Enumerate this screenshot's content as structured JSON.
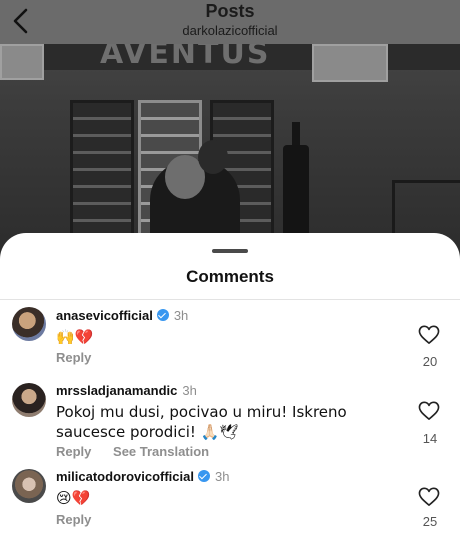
{
  "header": {
    "title": "Posts",
    "subtitle": "darkolazicofficial"
  },
  "photo": {
    "brand_text": "AVENTUS"
  },
  "sheet": {
    "title": "Comments"
  },
  "comments": [
    {
      "username": "anasevicofficial",
      "verified": true,
      "time": "3h",
      "text": "🙌💔",
      "reply_label": "Reply",
      "likes": "20"
    },
    {
      "username": "mrssladjanamandic",
      "verified": false,
      "time": "3h",
      "text": "Pokoj mu dusi, pocivao u miru! Iskreno saucesce porodici! 🙏🏻🕊",
      "reply_label": "Reply",
      "see_translation_label": "See Translation",
      "likes": "14"
    },
    {
      "username": "milicatodorovicofficial",
      "verified": true,
      "time": "3h",
      "text": "😢💔",
      "reply_label": "Reply",
      "likes": "25"
    }
  ],
  "colors": {
    "verified_badge": "#3897f0",
    "secondary_text": "#8e8e8e"
  }
}
